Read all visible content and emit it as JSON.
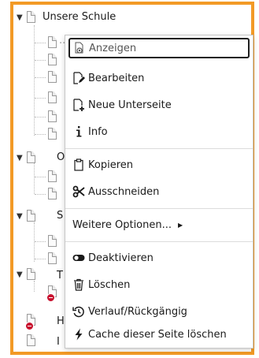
{
  "tree": {
    "root_label": "Unsere Schule",
    "root_partial_child": "...",
    "node_stubs": [
      "O",
      "S",
      "T",
      "H",
      "I"
    ]
  },
  "context_menu": {
    "items": {
      "show": "Anzeigen",
      "edit": "Bearbeiten",
      "new_subpage": "Neue Unterseite",
      "info": "Info",
      "copy": "Kopieren",
      "cut": "Ausschneiden",
      "more_options": "Weitere Optionen...",
      "disable": "Deaktivieren",
      "delete": "Löschen",
      "history": "Verlauf/Rückgängig",
      "clear_cache": "Cache dieser Seite löschen"
    },
    "icons": {
      "show": "view-page-icon",
      "edit": "edit-page-icon",
      "new_subpage": "new-subpage-icon",
      "info": "info-icon",
      "copy": "clipboard-icon",
      "cut": "scissors-icon",
      "more_options": "caret-right-icon",
      "disable": "toggle-icon",
      "delete": "trash-icon",
      "history": "history-icon",
      "clear_cache": "lightning-icon"
    }
  },
  "colors": {
    "focus_border": "#f29a26",
    "active_outline": "#1f1f1f",
    "deleted_badge": "#c8102e"
  }
}
